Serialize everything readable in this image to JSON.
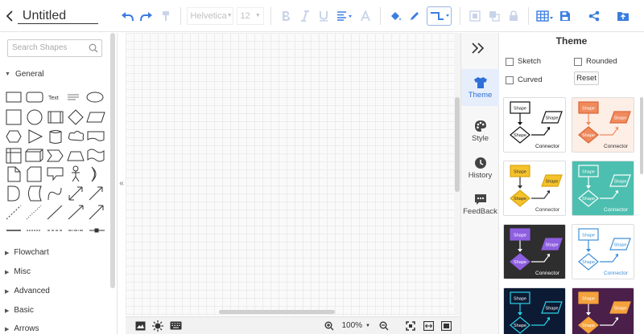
{
  "document": {
    "title": "Untitled"
  },
  "toolbar": {
    "font_family": "Helvetica",
    "font_size": "12"
  },
  "left_panel": {
    "search_placeholder": "Search Shapes",
    "shape_text_label": "Text",
    "categories": [
      "General",
      "Flowchart",
      "Misc",
      "Advanced",
      "Basic",
      "Arrows"
    ]
  },
  "canvas": {
    "zoom": "100%"
  },
  "side_tabs": [
    "Theme",
    "Style",
    "History",
    "FeedBack"
  ],
  "theme_panel": {
    "title": "Theme",
    "options": {
      "sketch": "Sketch",
      "rounded": "Rounded",
      "curved": "Curved",
      "reset": "Reset"
    },
    "card_shape_label": "Shape",
    "card_connector_label": "Connector",
    "cards": [
      {
        "bg": "#ffffff",
        "fill": "#ffffff",
        "stroke": "#111111",
        "text": "#111111",
        "line": "#111111",
        "conn": "#111111"
      },
      {
        "bg": "#fdeee6",
        "fill": "#f08a5d",
        "stroke": "#d9673a",
        "text": "#ffffff",
        "line": "#f08a5d",
        "conn": "#333333"
      },
      {
        "bg": "#ffffff",
        "fill": "#f5c22b",
        "stroke": "#d9a60f",
        "text": "#333333",
        "line": "#333333",
        "conn": "#333333"
      },
      {
        "bg": "#4dbfb0",
        "fill": "#4dbfb0",
        "stroke": "#ffffff",
        "text": "#ffffff",
        "line": "#ffffff",
        "conn": "#ffffff"
      },
      {
        "bg": "#2e2e2e",
        "fill": "#8e5fe0",
        "stroke": "#8e5fe0",
        "text": "#ffffff",
        "line": "#ffffff",
        "conn": "#ffffff"
      },
      {
        "bg": "#ffffff",
        "fill": "#ffffff",
        "stroke": "#3d8fd8",
        "text": "#3d8fd8",
        "line": "#3d8fd8",
        "conn": "#3d8fd8"
      },
      {
        "bg": "#0c1a33",
        "fill": "#0c1a33",
        "stroke": "#2ad3e8",
        "text": "#ffffff",
        "line": "#2ad3e8",
        "conn": "#ffffff"
      },
      {
        "bg": "#4a1f4a",
        "fill": "#f5a23c",
        "stroke": "#f5a23c",
        "text": "#ffffff",
        "line": "#ffffff",
        "conn": "#ffffff"
      }
    ]
  },
  "colors": {
    "accent": "#2e6fd8",
    "icon_blue": "#3b7de0",
    "disabled": "#c9d4e8"
  }
}
